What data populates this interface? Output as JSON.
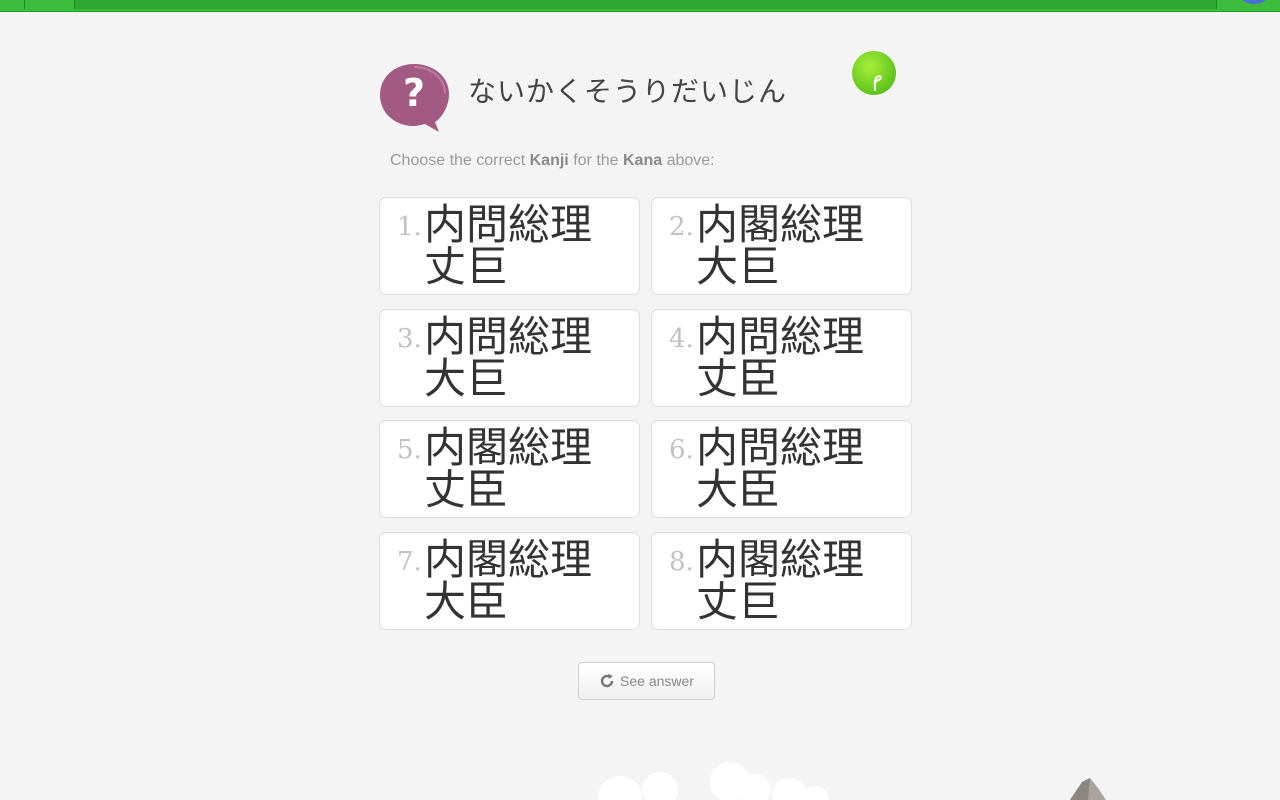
{
  "prompt": {
    "kana": "ないかくそうりだいじん",
    "instruction_pre": "Choose the correct ",
    "instruction_kanji": "Kanji",
    "instruction_mid": " for the ",
    "instruction_kana": "Kana",
    "instruction_post": " above:"
  },
  "options": [
    {
      "num": "1.",
      "kanji": "内問総理丈巨"
    },
    {
      "num": "2.",
      "kanji": "内閣総理大巨"
    },
    {
      "num": "3.",
      "kanji": "内問総理大巨"
    },
    {
      "num": "4.",
      "kanji": "内問総理丈臣"
    },
    {
      "num": "5.",
      "kanji": "内閣総理丈臣"
    },
    {
      "num": "6.",
      "kanji": "内問総理大臣"
    },
    {
      "num": "7.",
      "kanji": "内閣総理大臣"
    },
    {
      "num": "8.",
      "kanji": "内閣総理丈巨"
    }
  ],
  "actions": {
    "see_answer_label": "See answer"
  },
  "icons": {
    "question": "question-bubble-icon",
    "sprout": "sprout-icon",
    "refresh": "refresh-icon"
  },
  "colors": {
    "topbar": "#3dbb3d",
    "question_bubble": "#a35a82",
    "sprout": "#7fd81f"
  }
}
